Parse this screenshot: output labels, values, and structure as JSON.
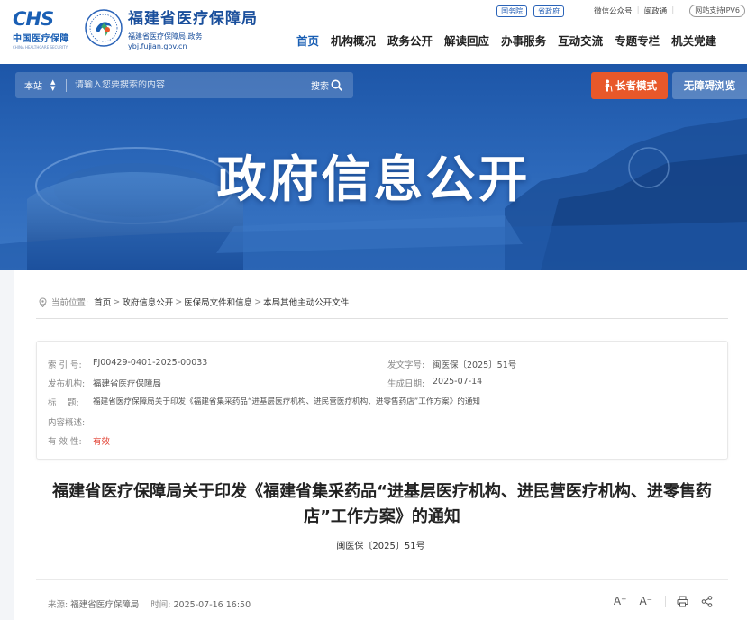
{
  "header": {
    "chs_logo_text": "CHS",
    "chs_logo_cn": "中国医疗保障",
    "chs_logo_en": "CHINA HEALTHCARE SECURITY",
    "site_name": "福建省医疗保障局",
    "site_subname": "福建省医疗保障局.政务",
    "site_domain": "ybj.fujian.gov.cn"
  },
  "topbar": {
    "pill_1": "国务院",
    "pill_2": "省政府",
    "link_wechat": "微信公众号",
    "link_minzhengtong": "闽政通",
    "ipv6": "网站支持IPV6"
  },
  "nav": {
    "items": [
      "首页",
      "机构概况",
      "政务公开",
      "解读回应",
      "办事服务",
      "互动交流",
      "专题专栏",
      "机关党建"
    ]
  },
  "search": {
    "scope": "本站",
    "placeholder": "请输入您要搜索的内容",
    "button": "搜索"
  },
  "banner": {
    "elder_mode": "长者模式",
    "accessible": "无障碍浏览",
    "title": "政府信息公开"
  },
  "breadcrumb": {
    "label": "当前位置:",
    "items": [
      "首页",
      "政府信息公开",
      "医保局文件和信息",
      "本局其他主动公开文件"
    ]
  },
  "meta": {
    "index_label": "索 引 号:",
    "index_value": "FJ00429-0401-2025-00033",
    "doc_no_label": "发文字号:",
    "doc_no_value": "闽医保〔2025〕51号",
    "issuer_label": "发布机构:",
    "issuer_value": "福建省医疗保障局",
    "date_label": "生成日期:",
    "date_value": "2025-07-14",
    "title_label": "标　 题:",
    "title_value": "福建省医疗保障局关于印发《福建省集采药品“进基层医疗机构、进民营医疗机构、进零售药店”工作方案》的通知",
    "summary_label": "内容概述:",
    "summary_value": "",
    "validity_label": "有 效 性:",
    "validity_value": "有效"
  },
  "document": {
    "title": "福建省医疗保障局关于印发《福建省集采药品“进基层医疗机构、进民营医疗机构、进零售药店”工作方案》的通知",
    "number": "闽医保〔2025〕51号",
    "source_label": "来源:",
    "source_value": "福建省医疗保障局",
    "time_label": "时间:",
    "time_value": "2025-07-16 16:50"
  },
  "tools": {
    "font_up": "A⁺",
    "font_down": "A⁻"
  },
  "colors": {
    "brand_blue": "#1a5fb4",
    "elder_orange": "#e8582a",
    "valid_red": "#e03a2b"
  }
}
